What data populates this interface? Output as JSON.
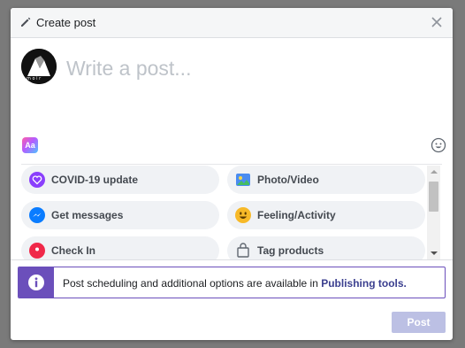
{
  "header": {
    "title": "Create post",
    "icon": "pencil-icon",
    "close_icon": "close-icon"
  },
  "composer": {
    "placeholder": "Write a post...",
    "text_format_label": "Aa",
    "emoji_icon": "emoji-icon"
  },
  "avatar": {
    "logo_text": "m"
  },
  "options": [
    {
      "name": "covid-19-update",
      "label": "COVID-19 update",
      "icon": "heart-icon",
      "color": "#8a3ffc"
    },
    {
      "name": "photo-video",
      "label": "Photo/Video",
      "icon": "photo-icon",
      "color": "#45bd62"
    },
    {
      "name": "get-messages",
      "label": "Get messages",
      "icon": "messenger-icon",
      "color": "#0a7cff"
    },
    {
      "name": "feeling-activity",
      "label": "Feeling/Activity",
      "icon": "smiley-icon",
      "color": "#f7b928"
    },
    {
      "name": "check-in",
      "label": "Check In",
      "icon": "location-pin-icon",
      "color": "#f02849"
    },
    {
      "name": "tag-products",
      "label": "Tag products",
      "icon": "shopping-bag-icon",
      "color": "#606770"
    }
  ],
  "notice": {
    "text": "Post scheduling and additional options are available in ",
    "link": "Publishing tools.",
    "accent": "#6b4fbb"
  },
  "post_button": {
    "label": "Post",
    "color": "#bcc0e4"
  }
}
